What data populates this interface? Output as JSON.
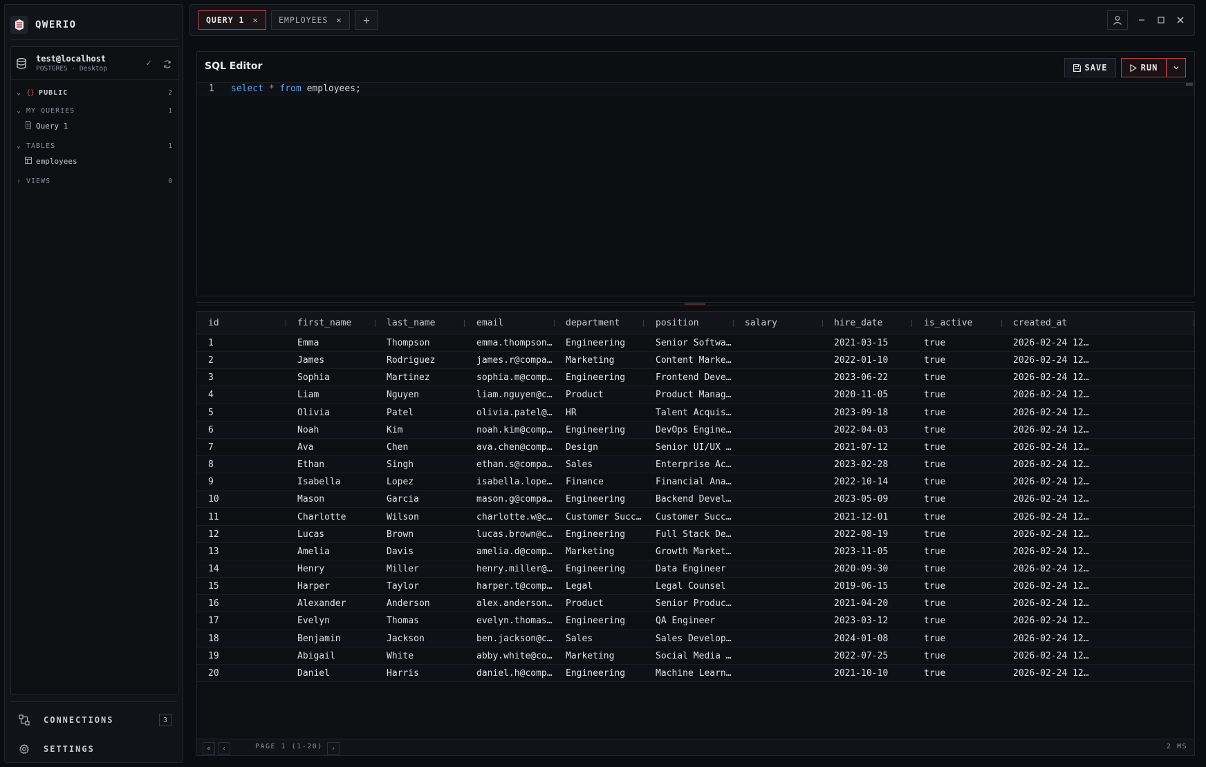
{
  "app": {
    "name": "QWERIO"
  },
  "connection": {
    "name": "test@localhost",
    "meta": "POSTGRES · Desktop"
  },
  "tree": {
    "schema": {
      "label": "PUBLIC",
      "count": "2"
    },
    "my_queries": {
      "label": "MY QUERIES",
      "count": "1",
      "items": [
        "Query 1"
      ]
    },
    "tables": {
      "label": "TABLES",
      "count": "1",
      "items": [
        "employees"
      ]
    },
    "views": {
      "label": "VIEWS",
      "count": "0"
    }
  },
  "sidebar_nav": {
    "connections": {
      "label": "CONNECTIONS",
      "badge": "3"
    },
    "settings": {
      "label": "SETTINGS"
    }
  },
  "tabs": [
    {
      "label": "QUERY 1",
      "active": true
    },
    {
      "label": "EMPLOYEES",
      "active": false
    }
  ],
  "editor": {
    "title": "SQL Editor",
    "save_label": "SAVE",
    "run_label": "RUN",
    "line_number": "1",
    "code": {
      "kw1": "select",
      "op": "*",
      "kw2": "from",
      "rest": "employees;"
    }
  },
  "results": {
    "columns": [
      "id",
      "first_name",
      "last_name",
      "email",
      "department",
      "position",
      "salary",
      "hire_date",
      "is_active",
      "created_at"
    ],
    "rows": [
      [
        "1",
        "Emma",
        "Thompson",
        "emma.thompson…",
        "Engineering",
        "Senior Softwa…",
        "",
        "2021-03-15",
        "true",
        "2026-02-24 12…"
      ],
      [
        "2",
        "James",
        "Rodriguez",
        "james.r@compa…",
        "Marketing",
        "Content Marke…",
        "",
        "2022-01-10",
        "true",
        "2026-02-24 12…"
      ],
      [
        "3",
        "Sophia",
        "Martinez",
        "sophia.m@comp…",
        "Engineering",
        "Frontend Deve…",
        "",
        "2023-06-22",
        "true",
        "2026-02-24 12…"
      ],
      [
        "4",
        "Liam",
        "Nguyen",
        "liam.nguyen@c…",
        "Product",
        "Product Manag…",
        "",
        "2020-11-05",
        "true",
        "2026-02-24 12…"
      ],
      [
        "5",
        "Olivia",
        "Patel",
        "olivia.patel@…",
        "HR",
        "Talent Acquis…",
        "",
        "2023-09-18",
        "true",
        "2026-02-24 12…"
      ],
      [
        "6",
        "Noah",
        "Kim",
        "noah.kim@comp…",
        "Engineering",
        "DevOps Engine…",
        "",
        "2022-04-03",
        "true",
        "2026-02-24 12…"
      ],
      [
        "7",
        "Ava",
        "Chen",
        "ava.chen@comp…",
        "Design",
        "Senior UI/UX …",
        "",
        "2021-07-12",
        "true",
        "2026-02-24 12…"
      ],
      [
        "8",
        "Ethan",
        "Singh",
        "ethan.s@compa…",
        "Sales",
        "Enterprise Ac…",
        "",
        "2023-02-28",
        "true",
        "2026-02-24 12…"
      ],
      [
        "9",
        "Isabella",
        "Lopez",
        "isabella.lope…",
        "Finance",
        "Financial Ana…",
        "",
        "2022-10-14",
        "true",
        "2026-02-24 12…"
      ],
      [
        "10",
        "Mason",
        "Garcia",
        "mason.g@compa…",
        "Engineering",
        "Backend Devel…",
        "",
        "2023-05-09",
        "true",
        "2026-02-24 12…"
      ],
      [
        "11",
        "Charlotte",
        "Wilson",
        "charlotte.w@c…",
        "Customer Succ…",
        "Customer Succ…",
        "",
        "2021-12-01",
        "true",
        "2026-02-24 12…"
      ],
      [
        "12",
        "Lucas",
        "Brown",
        "lucas.brown@c…",
        "Engineering",
        "Full Stack De…",
        "",
        "2022-08-19",
        "true",
        "2026-02-24 12…"
      ],
      [
        "13",
        "Amelia",
        "Davis",
        "amelia.d@comp…",
        "Marketing",
        "Growth Market…",
        "",
        "2023-11-05",
        "true",
        "2026-02-24 12…"
      ],
      [
        "14",
        "Henry",
        "Miller",
        "henry.miller@…",
        "Engineering",
        "Data Engineer",
        "",
        "2020-09-30",
        "true",
        "2026-02-24 12…"
      ],
      [
        "15",
        "Harper",
        "Taylor",
        "harper.t@comp…",
        "Legal",
        "Legal Counsel",
        "",
        "2019-06-15",
        "true",
        "2026-02-24 12…"
      ],
      [
        "16",
        "Alexander",
        "Anderson",
        "alex.anderson…",
        "Product",
        "Senior Produc…",
        "",
        "2021-04-20",
        "true",
        "2026-02-24 12…"
      ],
      [
        "17",
        "Evelyn",
        "Thomas",
        "evelyn.thomas…",
        "Engineering",
        "QA Engineer",
        "",
        "2023-03-12",
        "true",
        "2026-02-24 12…"
      ],
      [
        "18",
        "Benjamin",
        "Jackson",
        "ben.jackson@c…",
        "Sales",
        "Sales Develop…",
        "",
        "2024-01-08",
        "true",
        "2026-02-24 12…"
      ],
      [
        "19",
        "Abigail",
        "White",
        "abby.white@co…",
        "Marketing",
        "Social Media …",
        "",
        "2022-07-25",
        "true",
        "2026-02-24 12…"
      ],
      [
        "20",
        "Daniel",
        "Harris",
        "daniel.h@comp…",
        "Engineering",
        "Machine Learn…",
        "",
        "2021-10-10",
        "true",
        "2026-02-24 12…"
      ]
    ],
    "pagination": "PAGE 1 (1-20)",
    "timing": "2 MS"
  },
  "colors": {
    "accent": "#b5414a",
    "success": "#3fbf6a",
    "keyword": "#5fa3e8"
  },
  "icons": [
    "logo-icon",
    "database-icon",
    "check-icon",
    "refresh-icon",
    "chevron-down-icon",
    "chevron-right-icon",
    "braces-icon",
    "file-icon",
    "table-icon",
    "connections-icon",
    "gear-icon",
    "close-icon",
    "plus-icon",
    "user-icon",
    "minimize-icon",
    "maximize-icon",
    "save-icon",
    "play-icon",
    "first-page-icon",
    "prev-page-icon",
    "next-page-icon"
  ]
}
